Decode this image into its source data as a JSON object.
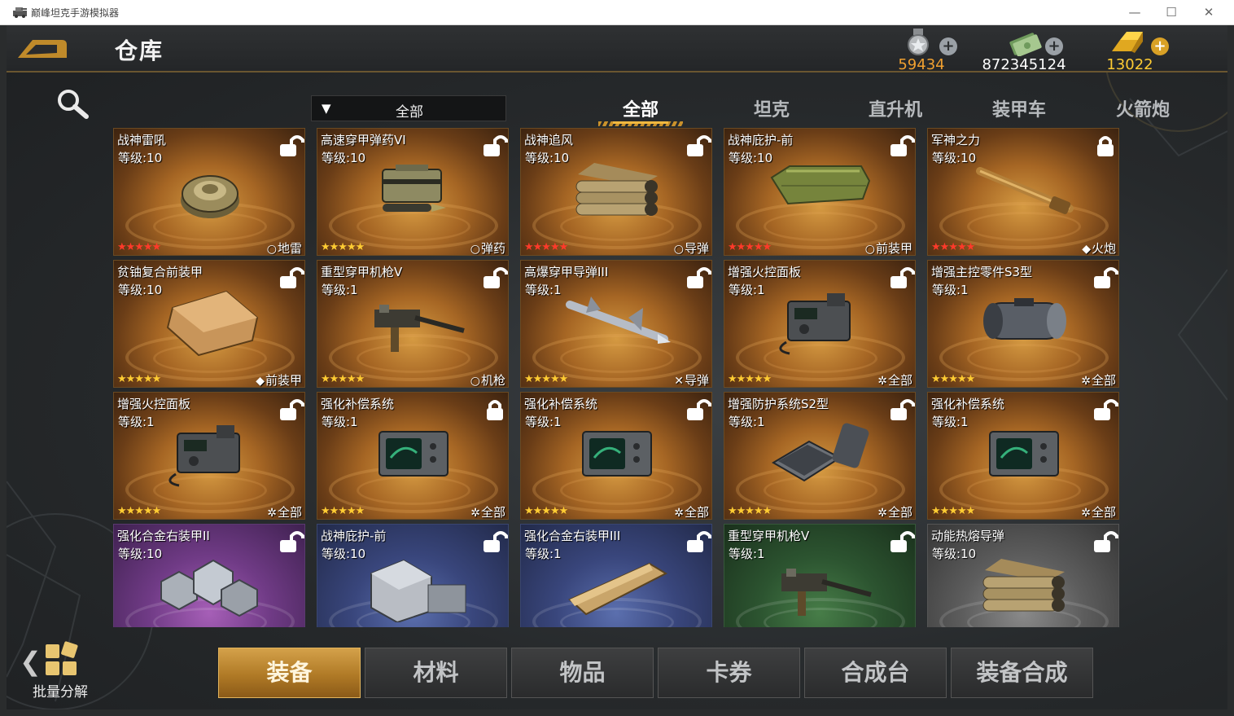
{
  "window": {
    "title": "巅峰坦克手游模拟器",
    "minimize_icon": "minimize-icon",
    "maximize_icon": "maximize-icon",
    "close_icon": "close-icon"
  },
  "header": {
    "title": "仓库",
    "currencies": [
      {
        "icon": "medal-icon",
        "value": "59434",
        "color": "#f0a030"
      },
      {
        "icon": "cash-icon",
        "value": "872345124",
        "color": "#ffffff"
      },
      {
        "icon": "gold-bar-icon",
        "value": "13022",
        "color": "#ffcc33"
      }
    ]
  },
  "filter": {
    "selected": "全部"
  },
  "category_tabs": [
    "全部",
    "坦克",
    "直升机",
    "装甲车",
    "火箭炮"
  ],
  "items": [
    {
      "name": "战神雷吼",
      "level": "等级:10",
      "tag": "地雷",
      "tag_icon": "○",
      "stars": "★★★★★",
      "star_color": "red",
      "locked": false,
      "art": "mine",
      "rarity": "gold"
    },
    {
      "name": "高速穿甲弹药VI",
      "level": "等级:10",
      "tag": "弹药",
      "tag_icon": "○",
      "stars": "★★★★★",
      "star_color": "gold",
      "locked": false,
      "art": "ammo",
      "rarity": "gold"
    },
    {
      "name": "战神追风",
      "level": "等级:10",
      "tag": "导弹",
      "tag_icon": "○",
      "stars": "★★★★★",
      "star_color": "red",
      "locked": false,
      "art": "launcher",
      "rarity": "gold"
    },
    {
      "name": "战神庇护-前",
      "level": "等级:10",
      "tag": "前装甲",
      "tag_icon": "○",
      "stars": "★★★★★",
      "star_color": "red",
      "locked": false,
      "art": "armor-green",
      "rarity": "gold"
    },
    {
      "name": "军神之力",
      "level": "等级:10",
      "tag": "火炮",
      "tag_icon": "◆",
      "stars": "★★★★★",
      "star_color": "red",
      "locked": true,
      "art": "barrel",
      "rarity": "gold"
    },
    {
      "name": "贫铀复合前装甲",
      "level": "等级:10",
      "tag": "前装甲",
      "tag_icon": "◆",
      "stars": "★★★★★",
      "star_color": "gold",
      "locked": false,
      "art": "plate",
      "rarity": "gold"
    },
    {
      "name": "重型穿甲机枪V",
      "level": "等级:1",
      "tag": "机枪",
      "tag_icon": "○",
      "stars": "★★★★★",
      "star_color": "gold",
      "locked": false,
      "art": "mg",
      "rarity": "gold"
    },
    {
      "name": "高爆穿甲导弹III",
      "level": "等级:1",
      "tag": "导弹",
      "tag_icon": "✕",
      "stars": "★★★★★",
      "star_color": "gold",
      "locked": false,
      "art": "missile",
      "rarity": "gold"
    },
    {
      "name": "增强火控面板",
      "level": "等级:1",
      "tag": "全部",
      "tag_icon": "✲",
      "stars": "★★★★★",
      "star_color": "gold",
      "locked": false,
      "art": "radio",
      "rarity": "gold"
    },
    {
      "name": "增强主控零件S3型",
      "level": "等级:1",
      "tag": "全部",
      "tag_icon": "✲",
      "stars": "★★★★★",
      "star_color": "gold",
      "locked": false,
      "art": "engine",
      "rarity": "gold"
    },
    {
      "name": "增强火控面板",
      "level": "等级:1",
      "tag": "全部",
      "tag_icon": "✲",
      "stars": "★★★★★",
      "star_color": "gold",
      "locked": false,
      "art": "radio",
      "rarity": "gold"
    },
    {
      "name": "强化补偿系统",
      "level": "等级:1",
      "tag": "全部",
      "tag_icon": "✲",
      "stars": "★★★★★",
      "star_color": "gold",
      "locked": true,
      "art": "radar",
      "rarity": "gold"
    },
    {
      "name": "强化补偿系统",
      "level": "等级:1",
      "tag": "全部",
      "tag_icon": "✲",
      "stars": "★★★★★",
      "star_color": "gold",
      "locked": false,
      "art": "radar",
      "rarity": "gold"
    },
    {
      "name": "增强防护系统S2型",
      "level": "等级:1",
      "tag": "全部",
      "tag_icon": "✲",
      "stars": "★★★★★",
      "star_color": "gold",
      "locked": false,
      "art": "keyboard",
      "rarity": "gold"
    },
    {
      "name": "强化补偿系统",
      "level": "等级:1",
      "tag": "全部",
      "tag_icon": "✲",
      "stars": "★★★★★",
      "star_color": "gold",
      "locked": false,
      "art": "radar",
      "rarity": "gold"
    },
    {
      "name": "强化合金右装甲II",
      "level": "等级:10",
      "tag": "",
      "tag_icon": "",
      "stars": "",
      "star_color": "gold",
      "locked": false,
      "art": "hexplates",
      "rarity": "purple"
    },
    {
      "name": "战神庇护-前",
      "level": "等级:10",
      "tag": "",
      "tag_icon": "",
      "stars": "",
      "star_color": "gold",
      "locked": false,
      "art": "block",
      "rarity": "blue"
    },
    {
      "name": "强化合金右装甲III",
      "level": "等级:1",
      "tag": "",
      "tag_icon": "",
      "stars": "",
      "star_color": "gold",
      "locked": false,
      "art": "plank",
      "rarity": "blue"
    },
    {
      "name": "重型穿甲机枪V",
      "level": "等级:1",
      "tag": "",
      "tag_icon": "",
      "stars": "",
      "star_color": "gold",
      "locked": false,
      "art": "mg",
      "rarity": "green"
    },
    {
      "name": "动能热熔导弹",
      "level": "等级:10",
      "tag": "",
      "tag_icon": "",
      "stars": "",
      "star_color": "gold",
      "locked": false,
      "art": "launcher",
      "rarity": "gray"
    }
  ],
  "batch": {
    "label": "批量分解",
    "icon": "grid-squares-icon"
  },
  "bottom_tabs": [
    "装备",
    "材料",
    "物品",
    "卡券",
    "合成台",
    "装备合成"
  ],
  "colors": {
    "accent": "#c9912b",
    "title_bar": "#ffffff",
    "game_bg": "#2a2c2d"
  }
}
